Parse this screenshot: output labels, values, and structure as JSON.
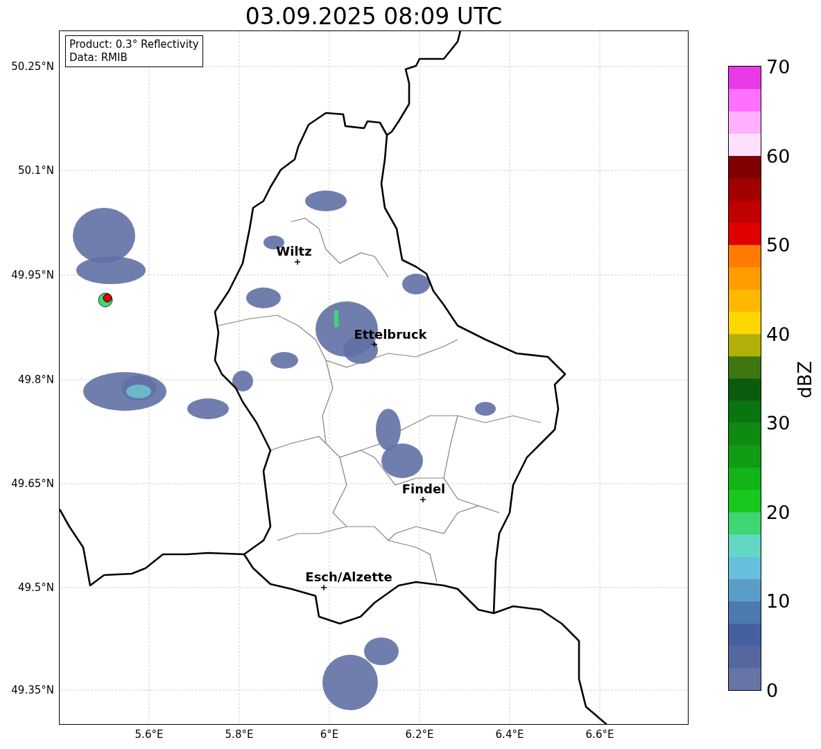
{
  "title": "03.09.2025 08:09 UTC",
  "info": {
    "lines": [
      "Product: 0.3° Reflectivity",
      "Data: RMIB"
    ]
  },
  "map": {
    "cities": [
      {
        "name": "Wiltz"
      },
      {
        "name": "Ettelbruck"
      },
      {
        "name": "Findel"
      },
      {
        "name": "Esch/Alzette"
      }
    ],
    "x_ticks": [
      "5.6°E",
      "5.8°E",
      "6°E",
      "6.2°E",
      "6.4°E",
      "6.6°E"
    ],
    "y_ticks": [
      "50.25°N",
      "50.1°N",
      "49.95°N",
      "49.8°N",
      "49.65°N",
      "49.5°N",
      "49.35°N"
    ]
  },
  "colorbar": {
    "label": "dBZ",
    "ticks": [
      "70",
      "60",
      "50",
      "40",
      "30",
      "20",
      "10",
      "0"
    ]
  }
}
